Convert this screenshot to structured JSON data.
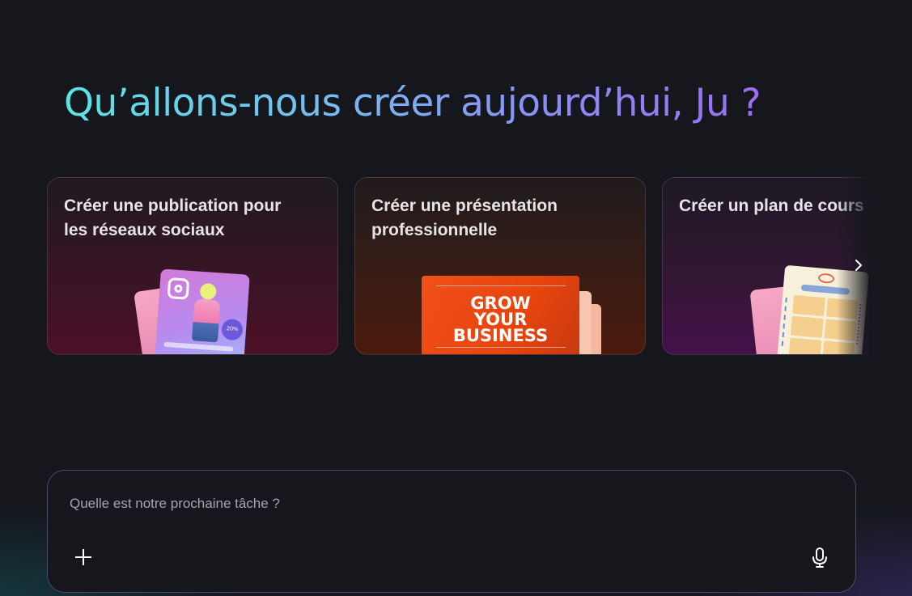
{
  "header": {
    "title": "Qu’allons-nous créer aujourd’hui, Ju ?"
  },
  "cards": [
    {
      "title": "Créer une publication pour\nles réseaux sociaux",
      "badge": "20%"
    },
    {
      "title": "Créer une présentation\nprofessionnelle",
      "slide_text": "GROW\nYOUR\nBUSINESS"
    },
    {
      "title": "Créer un plan de cours"
    }
  ],
  "carousel": {
    "next_icon": "chevron-right-icon"
  },
  "composer": {
    "placeholder": "Quelle est notre prochaine tâche ?",
    "add_icon": "plus-icon",
    "mic_icon": "microphone-icon"
  },
  "colors": {
    "background": "#15171c",
    "headline_gradient_start": "#5ee3e4",
    "headline_gradient_end": "#9b6df2",
    "composer_border": "#4c4876"
  }
}
